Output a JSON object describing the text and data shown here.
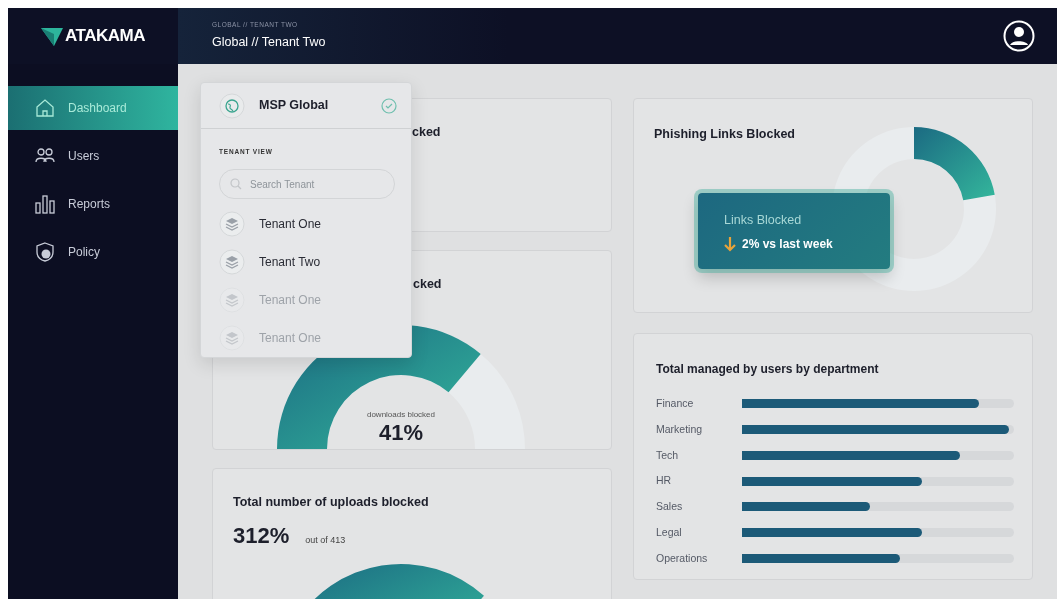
{
  "logo": {
    "text": "ATAKAMA"
  },
  "header": {
    "breadcrumb": "GLOBAL // TENANT TWO",
    "title": "Global // Tenant Two"
  },
  "sidebar": {
    "items": [
      {
        "label": "Dashboard",
        "kind": "home",
        "selected": true
      },
      {
        "label": "Users",
        "kind": "users",
        "selected": false
      },
      {
        "label": "Reports",
        "kind": "reports",
        "selected": false
      },
      {
        "label": "Policy",
        "kind": "policy",
        "selected": false
      }
    ]
  },
  "tenant_menu": {
    "current": "MSP Global",
    "section": "TENANT VIEW",
    "search": {
      "placeholder": "Search Tenant"
    },
    "items": [
      {
        "label": "Tenant One",
        "disabled": false
      },
      {
        "label": "Tenant Two",
        "disabled": false
      },
      {
        "label": "Tenant One",
        "disabled": true
      },
      {
        "label": "Tenant One",
        "disabled": true
      }
    ]
  },
  "cards": {
    "first": {
      "title": "cked"
    },
    "downloads": {
      "title": "cked",
      "caption": "downloads blocked",
      "value": "41%"
    },
    "uploads": {
      "title": "Total number of uploads blocked",
      "value": "312%",
      "detail": "out of 413"
    },
    "phishing": {
      "title": "Phishing Links Blocked",
      "tooltip": {
        "title": "Links Blocked",
        "change": "2% vs last week"
      }
    },
    "departments": {
      "title": "Total managed by users by department",
      "rows": [
        {
          "label": "Finance",
          "level": 0.87
        },
        {
          "label": "Marketing",
          "level": 0.98
        },
        {
          "label": "Tech",
          "level": 0.8
        },
        {
          "label": "HR",
          "level": 0.66
        },
        {
          "label": "Sales",
          "level": 0.47
        },
        {
          "label": "Legal",
          "level": 0.66
        },
        {
          "label": "Operations",
          "level": 0.58
        }
      ]
    }
  }
}
